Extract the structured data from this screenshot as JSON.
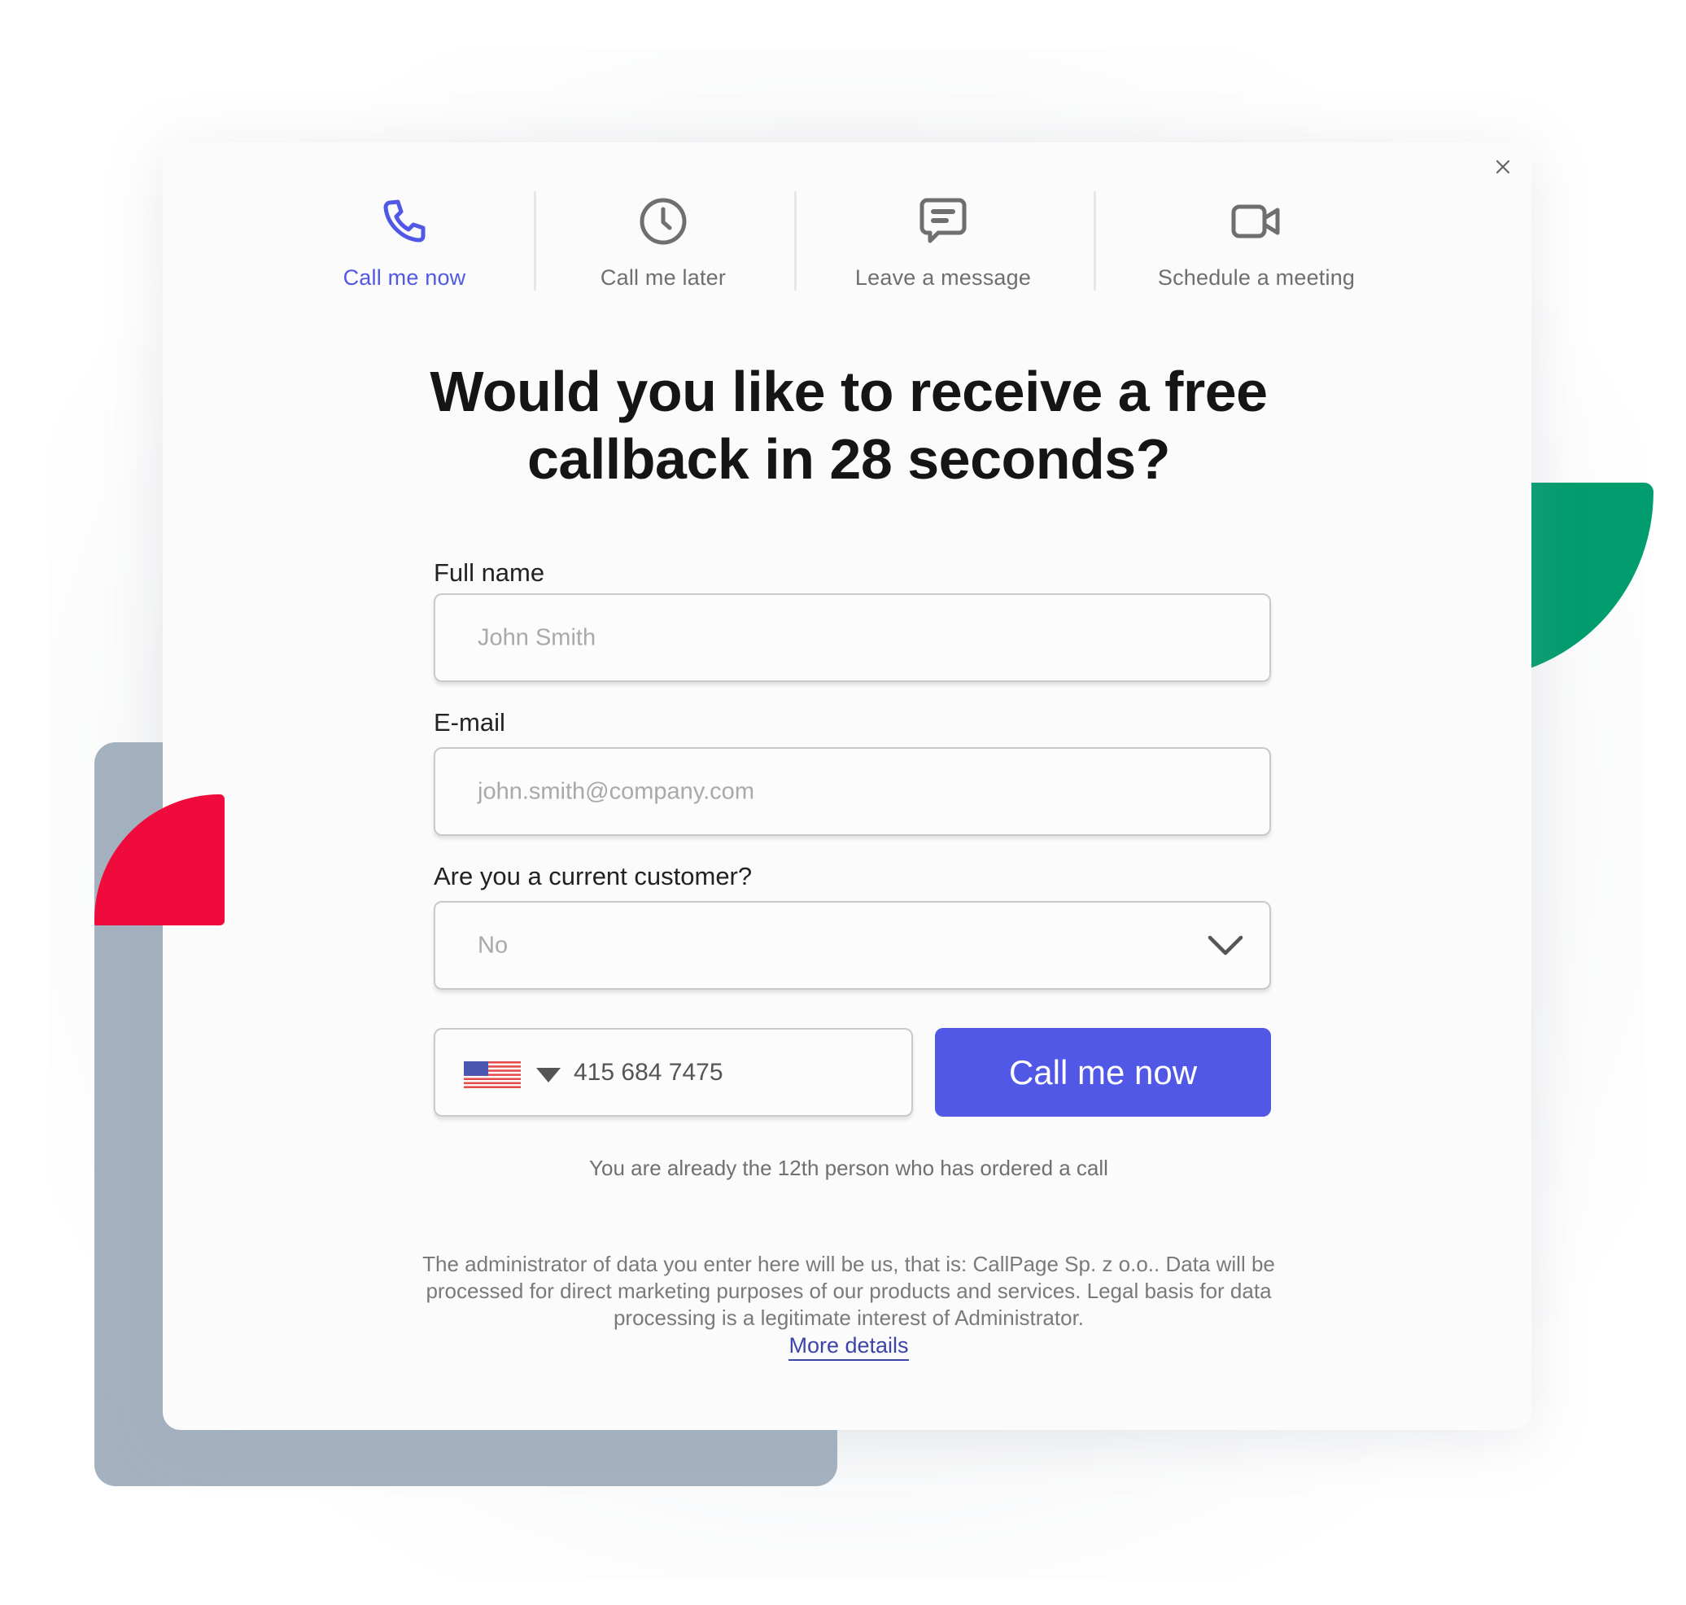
{
  "colors": {
    "accent": "#5058E5",
    "red_shape": "#EF0B3B",
    "green_shape": "#019D6E",
    "gray_panel": "#A4B2C0"
  },
  "close_icon": "close-icon",
  "tabs": [
    {
      "label": "Call me now",
      "icon": "phone-icon",
      "active": true
    },
    {
      "label": "Call me later",
      "icon": "clock-icon",
      "active": false
    },
    {
      "label": "Leave a message",
      "icon": "message-icon",
      "active": false
    },
    {
      "label": "Schedule a meeting",
      "icon": "video-icon",
      "active": false
    }
  ],
  "heading": {
    "line1": "Would you like to receive a free",
    "line2": "callback in 28 seconds?"
  },
  "form": {
    "full_name": {
      "label": "Full name",
      "placeholder": "John Smith",
      "value": ""
    },
    "email": {
      "label": "E-mail",
      "placeholder": "john.smith@company.com",
      "value": ""
    },
    "customer": {
      "label": "Are you a current customer?",
      "selected": "No"
    },
    "phone": {
      "country": "US",
      "country_icon": "us-flag-icon",
      "number": "415 684 7475"
    },
    "submit_label": "Call me now"
  },
  "counter_text": "You are already the 12th person who has ordered a call",
  "legal": {
    "text": "The administrator of data you enter here will be us, that is: CallPage Sp. z o.o.. Data will be processed for direct marketing purposes of our products and services. Legal basis for data processing is a legitimate interest of Administrator.",
    "link_label": "More details"
  }
}
